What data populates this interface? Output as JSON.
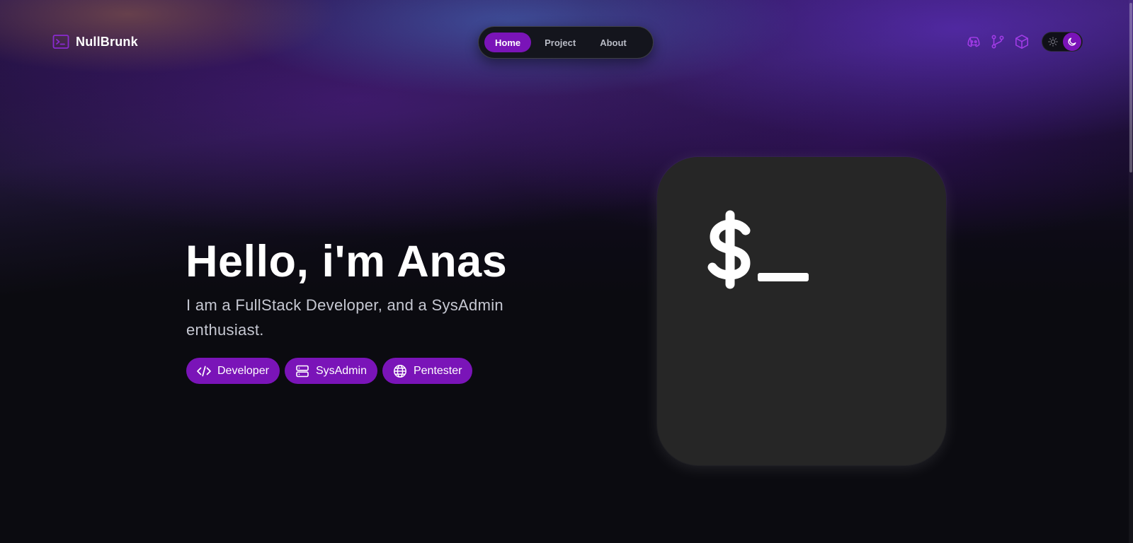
{
  "header": {
    "brand_name": "NullBrunk",
    "brand_icon": "terminal-icon",
    "nav": [
      {
        "label": "Home",
        "active": true
      },
      {
        "label": "Project",
        "active": false
      },
      {
        "label": "About",
        "active": false
      }
    ],
    "icons": [
      "discord-icon",
      "git-branch-icon",
      "cube-icon"
    ],
    "theme_toggle": {
      "options": [
        "sun-icon",
        "moon-icon"
      ],
      "selected": "dark"
    }
  },
  "hero": {
    "title": "Hello, i'm Anas",
    "subtitle": "I am a FullStack Developer, and a SysAdmin enthusiast.",
    "tags": [
      {
        "label": "Developer",
        "icon": "code-icon"
      },
      {
        "label": "SysAdmin",
        "icon": "server-icon"
      },
      {
        "label": "Pentester",
        "icon": "globe-icon"
      }
    ]
  },
  "terminal_card": {
    "prompt": "$_"
  },
  "colors": {
    "accent": "#7a14b8",
    "background": "#0b0b10",
    "card": "#262626",
    "text": "#ffffff",
    "muted_text": "#c6c8d2"
  }
}
